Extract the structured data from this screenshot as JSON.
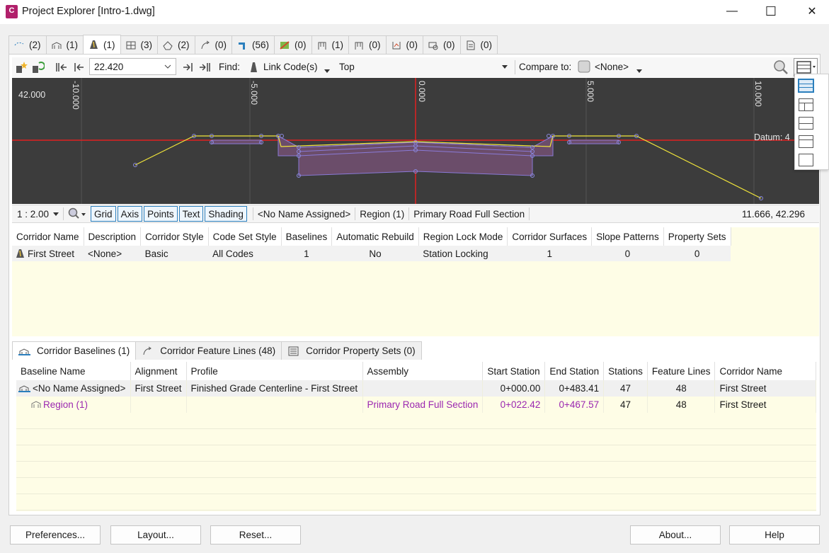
{
  "window": {
    "title": "Project Explorer [Intro-1.dwg]",
    "app_icon": "C",
    "minimize": "—",
    "maximize": "☐",
    "close": "✕"
  },
  "tabs": [
    "(2)",
    "(1)",
    "(1)",
    "(3)",
    "(2)",
    "(0)",
    "(56)",
    "(0)",
    "(1)",
    "(0)",
    "(0)",
    "(0)",
    "(0)"
  ],
  "toolbar": {
    "station_value": "22.420",
    "find_label": "Find:",
    "find_value": "Link Code(s)",
    "top_value": "Top",
    "compare_label": "Compare to:",
    "compare_value": "<None>"
  },
  "viewer": {
    "y_label": "42.000",
    "x_ticks": [
      "-10.000",
      "-5.000",
      "0.000",
      "5.000",
      "10.000"
    ],
    "datum_label": "Datum: 4"
  },
  "status": {
    "scale": "1 : 2.00",
    "toggles": [
      "Grid",
      "Axis",
      "Points",
      "Text",
      "Shading"
    ],
    "baseline": "<No Name Assigned>",
    "region": "Region (1)",
    "assembly": "Primary Road Full Section",
    "coords": "11.666, 42.296"
  },
  "corridor_table": {
    "headers": [
      "Corridor Name",
      "Description",
      "Corridor Style",
      "Code Set Style",
      "Baselines",
      "Automatic Rebuild",
      "Region Lock Mode",
      "Corridor Surfaces",
      "Slope Patterns",
      "Property Sets"
    ],
    "row": [
      "First Street",
      "<None>",
      "Basic",
      "All Codes",
      "1",
      "No",
      "Station Locking",
      "1",
      "0",
      "0"
    ]
  },
  "subtabs": [
    "Corridor Baselines (1)",
    "Corridor Feature Lines (48)",
    "Corridor Property Sets (0)"
  ],
  "baseline_table": {
    "headers": [
      "Baseline Name",
      "Alignment",
      "Profile",
      "Assembly",
      "Start Station",
      "End Station",
      "Stations",
      "Feature Lines",
      "Corridor Name"
    ],
    "rows": [
      [
        "<No Name Assigned>",
        "First Street",
        "Finished Grade Centerline - First Street",
        "",
        "0+000.00",
        "0+483.41",
        "47",
        "48",
        "First Street"
      ],
      [
        "Region (1)",
        "",
        "",
        "Primary Road Full Section",
        "0+022.42",
        "0+467.57",
        "47",
        "48",
        "First Street"
      ]
    ]
  },
  "buttons": {
    "preferences": "Preferences...",
    "layout": "Layout...",
    "reset": "Reset...",
    "about": "About...",
    "help": "Help"
  },
  "colors": {
    "accent_purple": "#9b27b0",
    "datum_red": "#e02020",
    "grid_yellow": "#fefde6"
  }
}
